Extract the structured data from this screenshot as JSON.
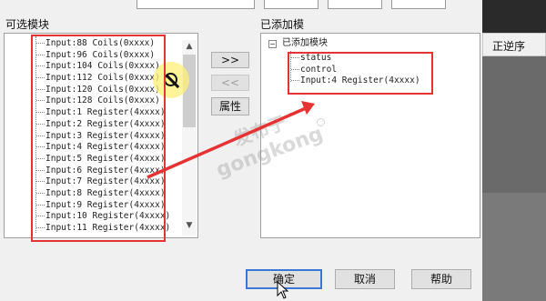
{
  "labels": {
    "available_modules": "可选模块",
    "added_modules": "已添加模",
    "column_header": "正逆序"
  },
  "left_list": {
    "items": [
      "Input:88 Coils(0xxxx)",
      "Input:96 Coils(0xxxx)",
      "Input:104 Coils(0xxxx)",
      "Input:112 Coils(0xxxx)",
      "Input:120 Coils(0xxxx)",
      "Input:128 Coils(0xxxx)",
      "Input:1 Register(4xxxx)",
      "Input:2 Register(4xxxx)",
      "Input:3 Register(4xxxx)",
      "Input:4 Register(4xxxx)",
      "Input:5 Register(4xxxx)",
      "Input:6 Register(4xxxx)",
      "Input:7 Register(4xxxx)",
      "Input:8 Register(4xxxx)",
      "Input:9 Register(4xxxx)",
      "Input:10 Register(4xxxx)",
      "Input:11 Register(4xxxx)"
    ]
  },
  "right_tree": {
    "root": "已添加模块",
    "children": [
      "status",
      "control",
      "Input:4 Register(4xxxx)"
    ]
  },
  "middle_buttons": {
    "add": ">>",
    "remove": "<<",
    "properties": "属性"
  },
  "bottom_buttons": {
    "ok": "确定",
    "cancel": "取消",
    "help": "帮助"
  },
  "watermark": {
    "line1": "发布于",
    "line2": "gongkong"
  },
  "colors": {
    "annotation_red": "#e53333",
    "default_button_border": "#3a78d6"
  },
  "icons": {
    "tree_collapse": "−"
  }
}
